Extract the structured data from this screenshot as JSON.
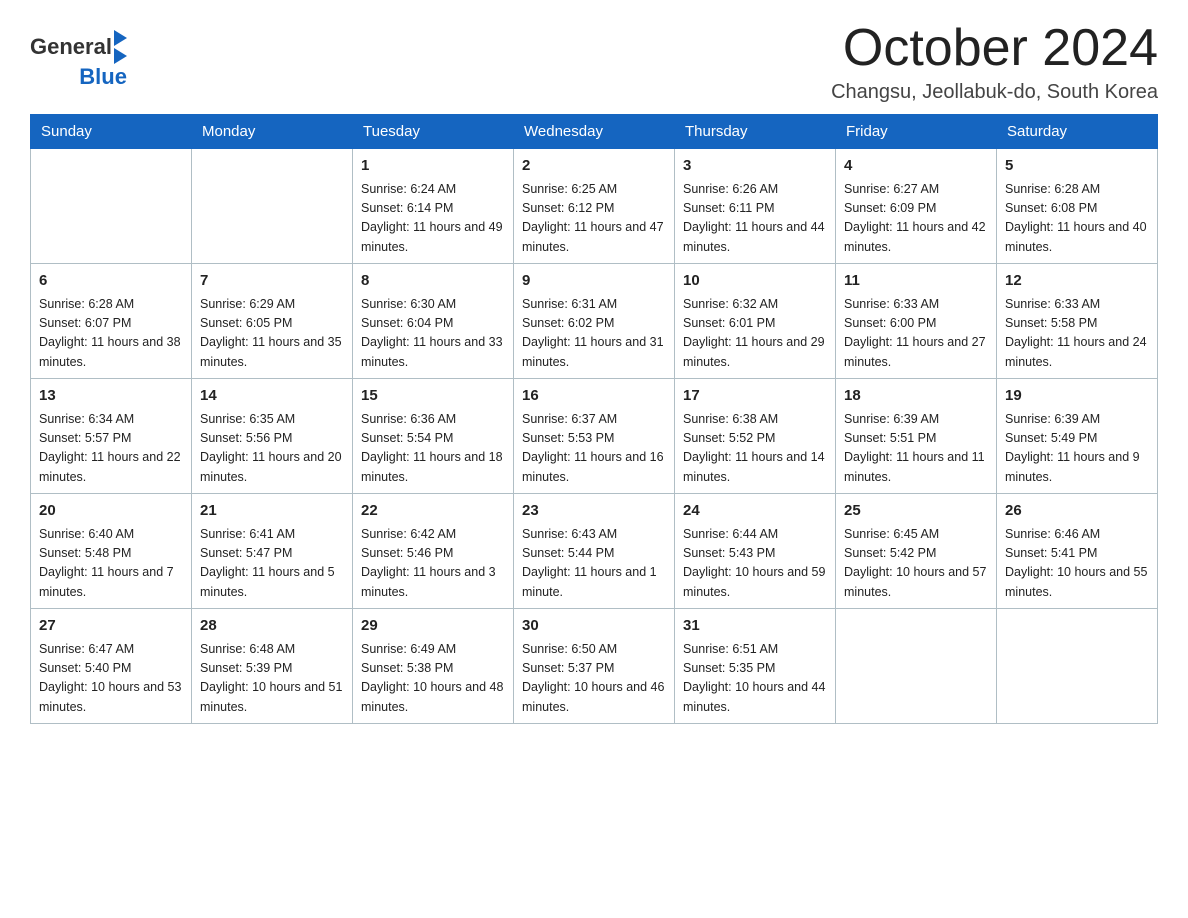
{
  "header": {
    "logo_general": "General",
    "logo_blue": "Blue",
    "title": "October 2024",
    "subtitle": "Changsu, Jeollabuk-do, South Korea"
  },
  "weekdays": [
    "Sunday",
    "Monday",
    "Tuesday",
    "Wednesday",
    "Thursday",
    "Friday",
    "Saturday"
  ],
  "weeks": [
    [
      {
        "day": "",
        "sunrise": "",
        "sunset": "",
        "daylight": ""
      },
      {
        "day": "",
        "sunrise": "",
        "sunset": "",
        "daylight": ""
      },
      {
        "day": "1",
        "sunrise": "Sunrise: 6:24 AM",
        "sunset": "Sunset: 6:14 PM",
        "daylight": "Daylight: 11 hours and 49 minutes."
      },
      {
        "day": "2",
        "sunrise": "Sunrise: 6:25 AM",
        "sunset": "Sunset: 6:12 PM",
        "daylight": "Daylight: 11 hours and 47 minutes."
      },
      {
        "day": "3",
        "sunrise": "Sunrise: 6:26 AM",
        "sunset": "Sunset: 6:11 PM",
        "daylight": "Daylight: 11 hours and 44 minutes."
      },
      {
        "day": "4",
        "sunrise": "Sunrise: 6:27 AM",
        "sunset": "Sunset: 6:09 PM",
        "daylight": "Daylight: 11 hours and 42 minutes."
      },
      {
        "day": "5",
        "sunrise": "Sunrise: 6:28 AM",
        "sunset": "Sunset: 6:08 PM",
        "daylight": "Daylight: 11 hours and 40 minutes."
      }
    ],
    [
      {
        "day": "6",
        "sunrise": "Sunrise: 6:28 AM",
        "sunset": "Sunset: 6:07 PM",
        "daylight": "Daylight: 11 hours and 38 minutes."
      },
      {
        "day": "7",
        "sunrise": "Sunrise: 6:29 AM",
        "sunset": "Sunset: 6:05 PM",
        "daylight": "Daylight: 11 hours and 35 minutes."
      },
      {
        "day": "8",
        "sunrise": "Sunrise: 6:30 AM",
        "sunset": "Sunset: 6:04 PM",
        "daylight": "Daylight: 11 hours and 33 minutes."
      },
      {
        "day": "9",
        "sunrise": "Sunrise: 6:31 AM",
        "sunset": "Sunset: 6:02 PM",
        "daylight": "Daylight: 11 hours and 31 minutes."
      },
      {
        "day": "10",
        "sunrise": "Sunrise: 6:32 AM",
        "sunset": "Sunset: 6:01 PM",
        "daylight": "Daylight: 11 hours and 29 minutes."
      },
      {
        "day": "11",
        "sunrise": "Sunrise: 6:33 AM",
        "sunset": "Sunset: 6:00 PM",
        "daylight": "Daylight: 11 hours and 27 minutes."
      },
      {
        "day": "12",
        "sunrise": "Sunrise: 6:33 AM",
        "sunset": "Sunset: 5:58 PM",
        "daylight": "Daylight: 11 hours and 24 minutes."
      }
    ],
    [
      {
        "day": "13",
        "sunrise": "Sunrise: 6:34 AM",
        "sunset": "Sunset: 5:57 PM",
        "daylight": "Daylight: 11 hours and 22 minutes."
      },
      {
        "day": "14",
        "sunrise": "Sunrise: 6:35 AM",
        "sunset": "Sunset: 5:56 PM",
        "daylight": "Daylight: 11 hours and 20 minutes."
      },
      {
        "day": "15",
        "sunrise": "Sunrise: 6:36 AM",
        "sunset": "Sunset: 5:54 PM",
        "daylight": "Daylight: 11 hours and 18 minutes."
      },
      {
        "day": "16",
        "sunrise": "Sunrise: 6:37 AM",
        "sunset": "Sunset: 5:53 PM",
        "daylight": "Daylight: 11 hours and 16 minutes."
      },
      {
        "day": "17",
        "sunrise": "Sunrise: 6:38 AM",
        "sunset": "Sunset: 5:52 PM",
        "daylight": "Daylight: 11 hours and 14 minutes."
      },
      {
        "day": "18",
        "sunrise": "Sunrise: 6:39 AM",
        "sunset": "Sunset: 5:51 PM",
        "daylight": "Daylight: 11 hours and 11 minutes."
      },
      {
        "day": "19",
        "sunrise": "Sunrise: 6:39 AM",
        "sunset": "Sunset: 5:49 PM",
        "daylight": "Daylight: 11 hours and 9 minutes."
      }
    ],
    [
      {
        "day": "20",
        "sunrise": "Sunrise: 6:40 AM",
        "sunset": "Sunset: 5:48 PM",
        "daylight": "Daylight: 11 hours and 7 minutes."
      },
      {
        "day": "21",
        "sunrise": "Sunrise: 6:41 AM",
        "sunset": "Sunset: 5:47 PM",
        "daylight": "Daylight: 11 hours and 5 minutes."
      },
      {
        "day": "22",
        "sunrise": "Sunrise: 6:42 AM",
        "sunset": "Sunset: 5:46 PM",
        "daylight": "Daylight: 11 hours and 3 minutes."
      },
      {
        "day": "23",
        "sunrise": "Sunrise: 6:43 AM",
        "sunset": "Sunset: 5:44 PM",
        "daylight": "Daylight: 11 hours and 1 minute."
      },
      {
        "day": "24",
        "sunrise": "Sunrise: 6:44 AM",
        "sunset": "Sunset: 5:43 PM",
        "daylight": "Daylight: 10 hours and 59 minutes."
      },
      {
        "day": "25",
        "sunrise": "Sunrise: 6:45 AM",
        "sunset": "Sunset: 5:42 PM",
        "daylight": "Daylight: 10 hours and 57 minutes."
      },
      {
        "day": "26",
        "sunrise": "Sunrise: 6:46 AM",
        "sunset": "Sunset: 5:41 PM",
        "daylight": "Daylight: 10 hours and 55 minutes."
      }
    ],
    [
      {
        "day": "27",
        "sunrise": "Sunrise: 6:47 AM",
        "sunset": "Sunset: 5:40 PM",
        "daylight": "Daylight: 10 hours and 53 minutes."
      },
      {
        "day": "28",
        "sunrise": "Sunrise: 6:48 AM",
        "sunset": "Sunset: 5:39 PM",
        "daylight": "Daylight: 10 hours and 51 minutes."
      },
      {
        "day": "29",
        "sunrise": "Sunrise: 6:49 AM",
        "sunset": "Sunset: 5:38 PM",
        "daylight": "Daylight: 10 hours and 48 minutes."
      },
      {
        "day": "30",
        "sunrise": "Sunrise: 6:50 AM",
        "sunset": "Sunset: 5:37 PM",
        "daylight": "Daylight: 10 hours and 46 minutes."
      },
      {
        "day": "31",
        "sunrise": "Sunrise: 6:51 AM",
        "sunset": "Sunset: 5:35 PM",
        "daylight": "Daylight: 10 hours and 44 minutes."
      },
      {
        "day": "",
        "sunrise": "",
        "sunset": "",
        "daylight": ""
      },
      {
        "day": "",
        "sunrise": "",
        "sunset": "",
        "daylight": ""
      }
    ]
  ]
}
